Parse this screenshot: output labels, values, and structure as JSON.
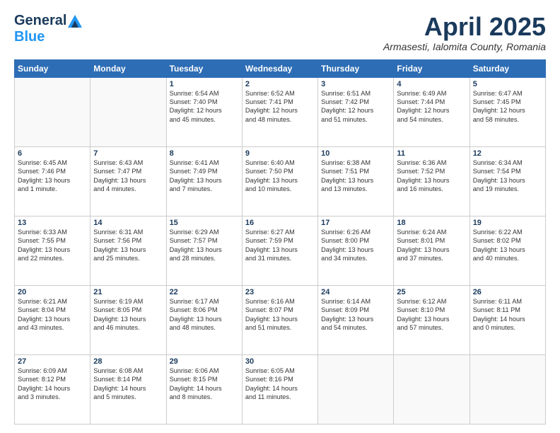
{
  "header": {
    "logo_general": "General",
    "logo_blue": "Blue",
    "month_title": "April 2025",
    "location": "Armasesti, Ialomita County, Romania"
  },
  "days_of_week": [
    "Sunday",
    "Monday",
    "Tuesday",
    "Wednesday",
    "Thursday",
    "Friday",
    "Saturday"
  ],
  "weeks": [
    [
      {
        "day": "",
        "info": ""
      },
      {
        "day": "",
        "info": ""
      },
      {
        "day": "1",
        "info": "Sunrise: 6:54 AM\nSunset: 7:40 PM\nDaylight: 12 hours\nand 45 minutes."
      },
      {
        "day": "2",
        "info": "Sunrise: 6:52 AM\nSunset: 7:41 PM\nDaylight: 12 hours\nand 48 minutes."
      },
      {
        "day": "3",
        "info": "Sunrise: 6:51 AM\nSunset: 7:42 PM\nDaylight: 12 hours\nand 51 minutes."
      },
      {
        "day": "4",
        "info": "Sunrise: 6:49 AM\nSunset: 7:44 PM\nDaylight: 12 hours\nand 54 minutes."
      },
      {
        "day": "5",
        "info": "Sunrise: 6:47 AM\nSunset: 7:45 PM\nDaylight: 12 hours\nand 58 minutes."
      }
    ],
    [
      {
        "day": "6",
        "info": "Sunrise: 6:45 AM\nSunset: 7:46 PM\nDaylight: 13 hours\nand 1 minute."
      },
      {
        "day": "7",
        "info": "Sunrise: 6:43 AM\nSunset: 7:47 PM\nDaylight: 13 hours\nand 4 minutes."
      },
      {
        "day": "8",
        "info": "Sunrise: 6:41 AM\nSunset: 7:49 PM\nDaylight: 13 hours\nand 7 minutes."
      },
      {
        "day": "9",
        "info": "Sunrise: 6:40 AM\nSunset: 7:50 PM\nDaylight: 13 hours\nand 10 minutes."
      },
      {
        "day": "10",
        "info": "Sunrise: 6:38 AM\nSunset: 7:51 PM\nDaylight: 13 hours\nand 13 minutes."
      },
      {
        "day": "11",
        "info": "Sunrise: 6:36 AM\nSunset: 7:52 PM\nDaylight: 13 hours\nand 16 minutes."
      },
      {
        "day": "12",
        "info": "Sunrise: 6:34 AM\nSunset: 7:54 PM\nDaylight: 13 hours\nand 19 minutes."
      }
    ],
    [
      {
        "day": "13",
        "info": "Sunrise: 6:33 AM\nSunset: 7:55 PM\nDaylight: 13 hours\nand 22 minutes."
      },
      {
        "day": "14",
        "info": "Sunrise: 6:31 AM\nSunset: 7:56 PM\nDaylight: 13 hours\nand 25 minutes."
      },
      {
        "day": "15",
        "info": "Sunrise: 6:29 AM\nSunset: 7:57 PM\nDaylight: 13 hours\nand 28 minutes."
      },
      {
        "day": "16",
        "info": "Sunrise: 6:27 AM\nSunset: 7:59 PM\nDaylight: 13 hours\nand 31 minutes."
      },
      {
        "day": "17",
        "info": "Sunrise: 6:26 AM\nSunset: 8:00 PM\nDaylight: 13 hours\nand 34 minutes."
      },
      {
        "day": "18",
        "info": "Sunrise: 6:24 AM\nSunset: 8:01 PM\nDaylight: 13 hours\nand 37 minutes."
      },
      {
        "day": "19",
        "info": "Sunrise: 6:22 AM\nSunset: 8:02 PM\nDaylight: 13 hours\nand 40 minutes."
      }
    ],
    [
      {
        "day": "20",
        "info": "Sunrise: 6:21 AM\nSunset: 8:04 PM\nDaylight: 13 hours\nand 43 minutes."
      },
      {
        "day": "21",
        "info": "Sunrise: 6:19 AM\nSunset: 8:05 PM\nDaylight: 13 hours\nand 46 minutes."
      },
      {
        "day": "22",
        "info": "Sunrise: 6:17 AM\nSunset: 8:06 PM\nDaylight: 13 hours\nand 48 minutes."
      },
      {
        "day": "23",
        "info": "Sunrise: 6:16 AM\nSunset: 8:07 PM\nDaylight: 13 hours\nand 51 minutes."
      },
      {
        "day": "24",
        "info": "Sunrise: 6:14 AM\nSunset: 8:09 PM\nDaylight: 13 hours\nand 54 minutes."
      },
      {
        "day": "25",
        "info": "Sunrise: 6:12 AM\nSunset: 8:10 PM\nDaylight: 13 hours\nand 57 minutes."
      },
      {
        "day": "26",
        "info": "Sunrise: 6:11 AM\nSunset: 8:11 PM\nDaylight: 14 hours\nand 0 minutes."
      }
    ],
    [
      {
        "day": "27",
        "info": "Sunrise: 6:09 AM\nSunset: 8:12 PM\nDaylight: 14 hours\nand 3 minutes."
      },
      {
        "day": "28",
        "info": "Sunrise: 6:08 AM\nSunset: 8:14 PM\nDaylight: 14 hours\nand 5 minutes."
      },
      {
        "day": "29",
        "info": "Sunrise: 6:06 AM\nSunset: 8:15 PM\nDaylight: 14 hours\nand 8 minutes."
      },
      {
        "day": "30",
        "info": "Sunrise: 6:05 AM\nSunset: 8:16 PM\nDaylight: 14 hours\nand 11 minutes."
      },
      {
        "day": "",
        "info": ""
      },
      {
        "day": "",
        "info": ""
      },
      {
        "day": "",
        "info": ""
      }
    ]
  ]
}
